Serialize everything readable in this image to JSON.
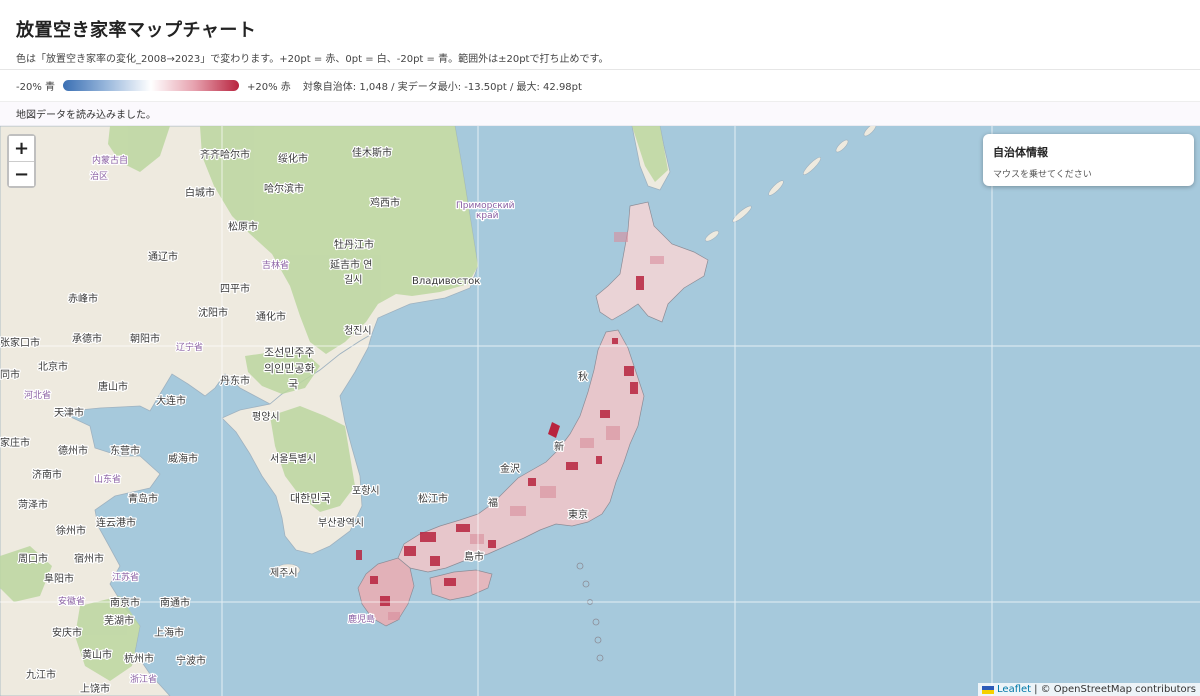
{
  "header": {
    "title": "放置空き家率マップチャート",
    "subtitle": "色は「放置空き家率の変化_2008→2023」で変わります。+20pt = 赤、0pt = 白、-20pt = 青。範囲外は±20ptで打ち止めです。"
  },
  "legend": {
    "min_label": "-20% 青",
    "max_label": "+20% 赤",
    "meta": "対象自治体: 1,048 / 実データ最小: -13.50pt / 最大: 42.98pt",
    "colors": {
      "low": "#3a6fb3",
      "mid": "#ffffff",
      "high": "#b8243f"
    }
  },
  "status": "地図データを読み込みました。",
  "map": {
    "zoom_in": "+",
    "zoom_out": "−",
    "info_title": "自治体情報",
    "info_hint": "マウスを乗せてください",
    "attribution_leaflet": "Leaflet",
    "attribution_rest": "| © OpenStreetMap contributors",
    "labels": {
      "neimenggu": "内蒙古自",
      "zhiqu": "治区",
      "qiqihar": "齐齐哈尔市",
      "suihua": "绥化市",
      "jiamusi": "佳木斯市",
      "baicheng": "白城市",
      "harbin": "哈尔滨市",
      "jixi": "鸡西市",
      "primorsky1": "Приморский",
      "primorsky2": "край",
      "songyuan": "松原市",
      "mudanjiang": "牡丹江市",
      "tongliao": "通辽市",
      "jilin": "吉林省",
      "yanji": "延吉市 연",
      "gilsi": "길시",
      "vladivostok": "Владивосток",
      "chifeng": "赤峰市",
      "siping": "四平市",
      "shenyang": "沈阳市",
      "tonghua": "通化市",
      "chengde": "承德市",
      "chaoyang": "朝阳市",
      "liaoning": "辽宁省",
      "cheongjin": "청진시",
      "zhangjiakou": "张家口市",
      "dprk1": "조선민주주",
      "dprk2": "의인민공화",
      "dprk3": "국",
      "dandong": "丹东市",
      "tongshi": "同市",
      "beijing": "北京市",
      "tangshan": "唐山市",
      "hebei": "河北省",
      "dalian": "大连市",
      "pyongyang": "평양시",
      "tianjin": "天津市",
      "akita": "秋",
      "jiazhuang": "家庄市",
      "dezhou": "德州市",
      "dongying": "东营市",
      "weihai": "威海市",
      "seoul": "서울특별시",
      "niigata": "新",
      "kanazawa": "金沢",
      "jinan": "济南市",
      "shandong": "山东省",
      "qingdao": "青岛市",
      "rok": "대한민국",
      "pohang": "포항시",
      "matsue": "松江市",
      "heze": "菏泽市",
      "xuzhou": "徐州市",
      "lianyungang": "连云港市",
      "busan": "부산광역시",
      "zhoukou": "周口市",
      "suzhou": "宿州市",
      "jeju": "제주시",
      "fuyang": "阜阳市",
      "jiangsu": "江苏省",
      "anhui": "安徽省",
      "nanjing": "南京市",
      "nantong": "南通市",
      "wuhu": "芜湖市",
      "shanghai": "上海市",
      "kagoshima": "鹿児島",
      "anqing": "安庆市",
      "huangshan": "黄山市",
      "hangzhou": "杭州市",
      "ningbo": "宁波市",
      "jiujiang": "九江市",
      "shangrao": "上饶市",
      "zhejiang": "浙江省",
      "tokyo": "東京",
      "fuku": "福",
      "hiro": "島市"
    }
  }
}
